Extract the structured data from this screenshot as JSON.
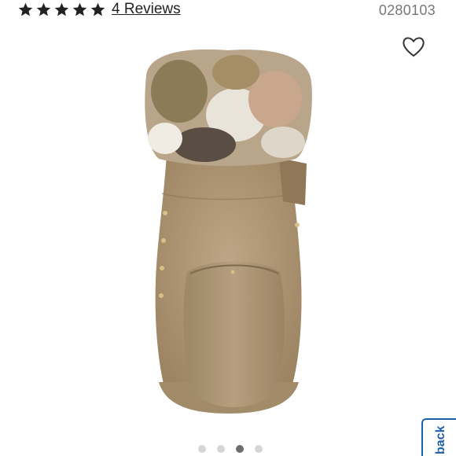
{
  "rating": {
    "stars": 5,
    "max_stars": 5,
    "reviews_label": "4 Reviews"
  },
  "product": {
    "sku": "0280103"
  },
  "icons": {
    "favorite": "heart-outline-icon",
    "star": "star-filled-icon"
  },
  "carousel": {
    "total": 4,
    "active_index": 2
  },
  "feedback": {
    "label": "back"
  },
  "colors": {
    "star": "#222222",
    "boot": "#b19a78",
    "accent": "#1f5fa8"
  }
}
